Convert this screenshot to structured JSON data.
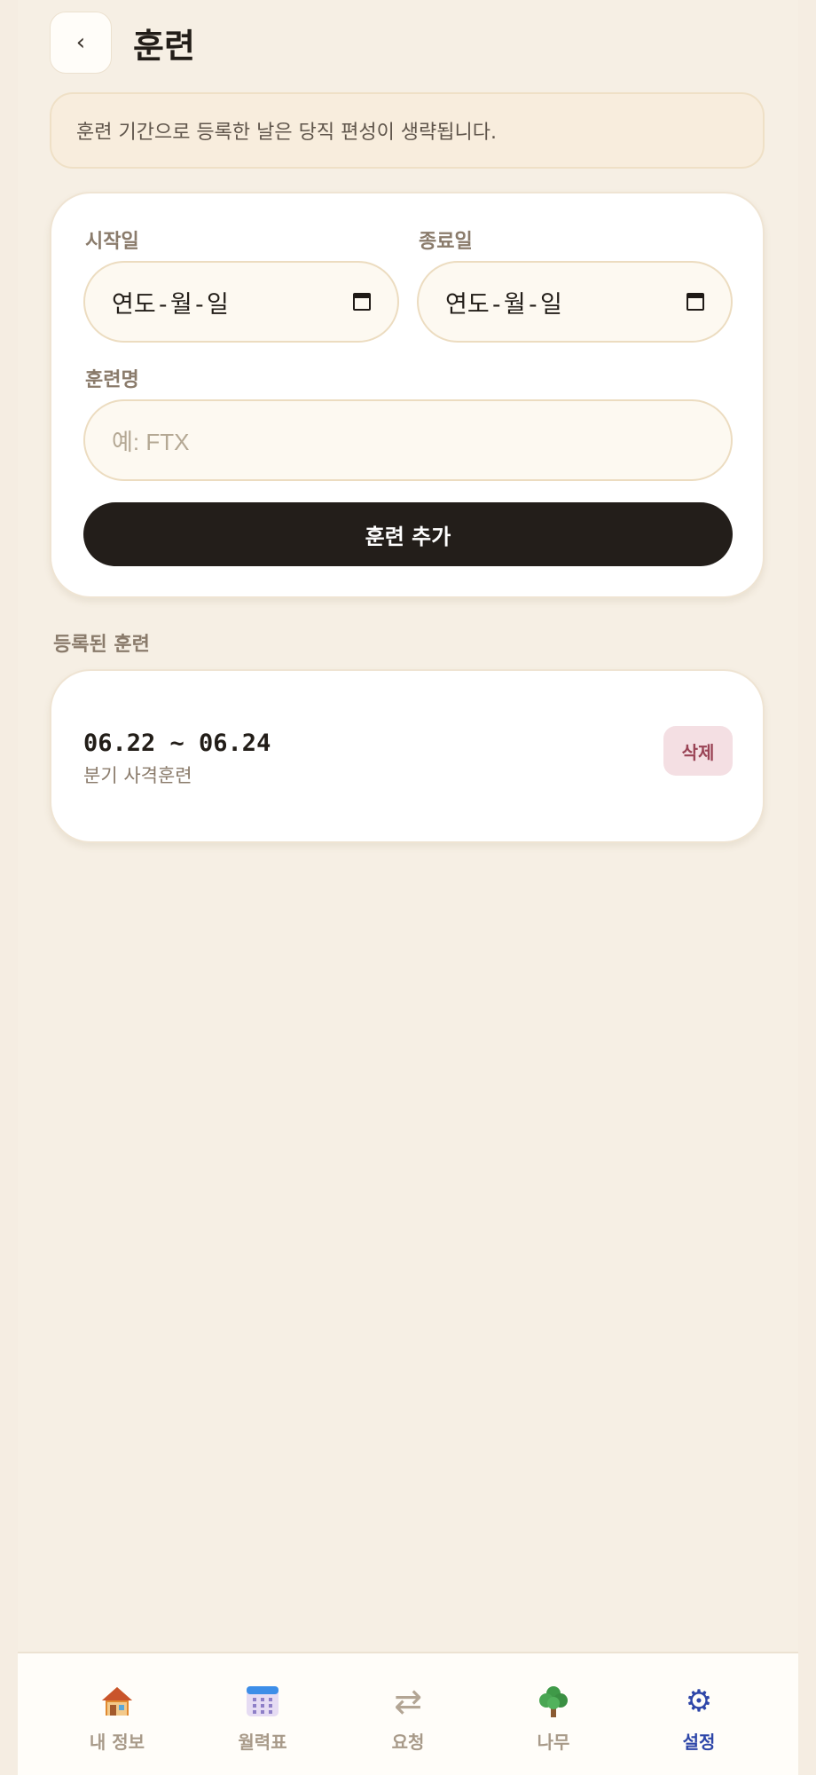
{
  "header": {
    "back_icon": "chevron-left-icon",
    "back_glyph": "‹",
    "title": "훈련"
  },
  "notice": {
    "text": "훈련 기간으로 등록한 날은 당직 편성이 생략됩니다."
  },
  "form": {
    "start_date": {
      "label": "시작일",
      "value": "연도-월-일",
      "icon": "calendar-icon"
    },
    "end_date": {
      "label": "종료일",
      "value": "연도-월-일",
      "icon": "calendar-icon"
    },
    "name": {
      "label": "훈련명",
      "placeholder": "예: FTX",
      "value": ""
    },
    "submit_label": "훈련 추가"
  },
  "registered": {
    "section_title": "등록된 훈련",
    "items": [
      {
        "range": "06.22 ~ 06.24",
        "name": "분기 사격훈련",
        "delete_label": "삭제"
      }
    ]
  },
  "nav": {
    "active": "settings",
    "items": [
      {
        "id": "my-info",
        "label": "내 정보",
        "icon": "house-icon"
      },
      {
        "id": "calendar",
        "label": "월력표",
        "icon": "calendar-grid-icon"
      },
      {
        "id": "request",
        "label": "요청",
        "icon": "swap-arrows-icon",
        "glyph": "⇄"
      },
      {
        "id": "tree",
        "label": "나무",
        "icon": "tree-icon"
      },
      {
        "id": "settings",
        "label": "설정",
        "icon": "gear-icon",
        "glyph": "⚙"
      }
    ]
  },
  "colors": {
    "background": "#f6efe4",
    "primary_button": "#231e1a",
    "active_nav": "#2e46a8",
    "delete_bg": "#f4dfe3",
    "delete_text": "#9a4456"
  }
}
